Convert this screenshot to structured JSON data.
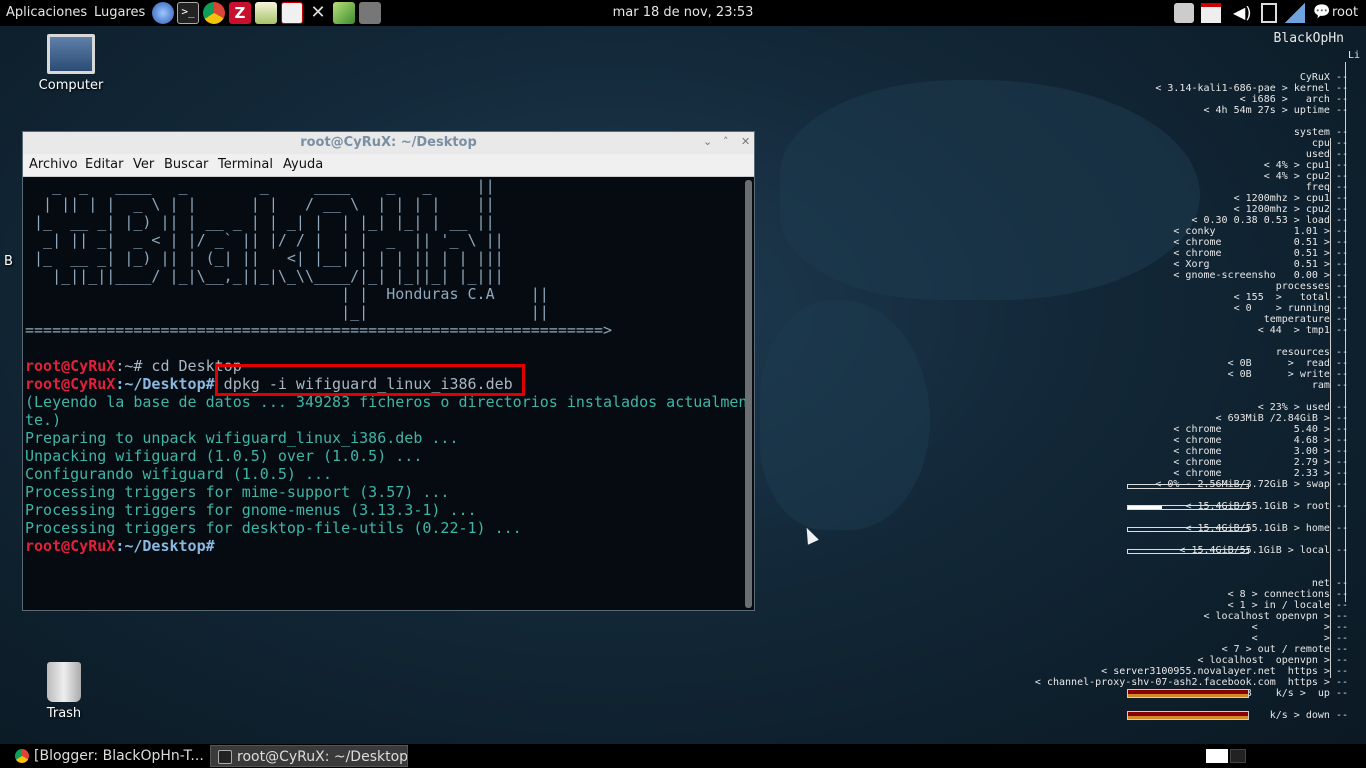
{
  "top_panel": {
    "applications": "Aplicaciones",
    "places": "Lugares",
    "clock": "mar 18 de nov, 23:53",
    "user": "root",
    "launchers": [
      "iceweasel-icon",
      "terminal-icon",
      "chrome-icon",
      "filezilla-icon",
      "text-editor-icon",
      "wine-icon",
      "tools-icon",
      "leafpad-icon",
      "blank-icon"
    ]
  },
  "desktop": {
    "computer_label": "Computer",
    "trash_label": "Trash",
    "partial_label": "B"
  },
  "terminal": {
    "title": "root@CyRuX: ~/Desktop",
    "menu": [
      "Archivo",
      "Editar",
      "Ver",
      "Buscar",
      "Terminal",
      "Ayuda"
    ],
    "banner": [
      "   _  _   ____   _        _     ____    _   _     ||",
      "  | || | |  _ \\ | |      | |   / __ \\  | | | |    ||",
      " |_  __ _| |_) || | __ _ | | _| |  | |_| |_| | __ ||",
      "  _| || _|  _ < | |/ _` || |/ / |  | |  _  || '_ \\ ||",
      " |_  __ _| |_) || | (_| ||   <| |__| | | | || | | |||",
      "   |_||_||____/ |_|\\__,_||_|\\_\\\\____/|_| |_||_| |_|||",
      "                                   | |  Honduras C.A    ||",
      "                                   |_|                  ||",
      "================================================================>"
    ],
    "lines": [
      {
        "prompt": "root@CyRuX",
        "path": ":~#",
        "cmd": " cd Desktop"
      },
      {
        "prompt": "root@CyRuX",
        "path": ":~/Desktop#",
        "cmd": " dpkg -i wifiguard_linux_i386.deb"
      }
    ],
    "output": [
      "(Leyendo la base de datos ... 349283 ficheros o directorios instalados actualmen",
      "te.)",
      "Preparing to unpack wifiguard_linux_i386.deb ...",
      "Unpacking wifiguard (1.0.5) over (1.0.5) ...",
      "Configurando wifiguard (1.0.5) ...",
      "Processing triggers for mime-support (3.57) ...",
      "Processing triggers for gnome-menus (3.13.3-1) ...",
      "Processing triggers for desktop-file-utils (0.22-1) ..."
    ],
    "final_prompt": {
      "prompt": "root@CyRuX",
      "path": ":~/Desktop#"
    }
  },
  "conky": {
    "header": "BlackOpHn",
    "sub": "Li",
    "lines": [
      "CyRuX --",
      "< 3.14-kali1-686-pae > kernel --",
      "< i686 >   arch --",
      "< 4h 54m 27s > uptime --",
      "",
      "system --",
      "cpu --",
      "used --",
      "< 4% > cpu1 --",
      "< 4% > cpu2 --",
      "freq --",
      "< 1200mhz > cpu1 --",
      "< 1200mhz > cpu2 --",
      "< 0.30 0.38 0.53 > load --",
      "< conky             1.01 > --",
      "< chrome            0.51 > --",
      "< chrome            0.51 > --",
      "< Xorg              0.51 > --",
      "< gnome-screensho   0.00 > --",
      "processes --",
      "< 155  >   total --",
      "< 0    > running --",
      "temperature --",
      "< 44  > tmp1 --",
      "",
      "resources --",
      "< 0B      >  read --",
      "< 0B      > write --",
      "ram --",
      "",
      "< 23% > used --",
      "< 693MiB /2.84GiB > --",
      "< chrome            5.40 > --",
      "< chrome            4.68 > --",
      "< chrome            3.00 > --",
      "< chrome            2.79 > --",
      "< chrome            2.33 > --",
      "< 0% - 2.56MiB/3.72GiB > swap --",
      "",
      "< 15.4GiB/55.1GiB > root --",
      "",
      "< 15.4GiB/55.1GiB > home --",
      "",
      "< 15.4GiB/55.1GiB > local --",
      "",
      "",
      "net --",
      "< 8 > connections --",
      "< 1 > in / locale --",
      "< localhost openvpn > --",
      "<           > --",
      "<           > --",
      "< 7 > out / remote --",
      "< localhost  openvpn > --",
      "< server3100955.novalayer.net  https > --",
      "< channel-proxy-shv-07-ash2.facebook.com  https > --",
      "< 703B    k/s >  up --",
      "",
      "< 596B    k/s > down --",
      ""
    ],
    "bars": {
      "root_fill": 0.28,
      "home_fill": 0.28,
      "local_fill": 0.28,
      "swap_fill": 0.0
    }
  },
  "taskbar": {
    "tasks": [
      "[Blogger: BlackOpHn-T...",
      "root@CyRuX: ~/Desktop"
    ]
  }
}
